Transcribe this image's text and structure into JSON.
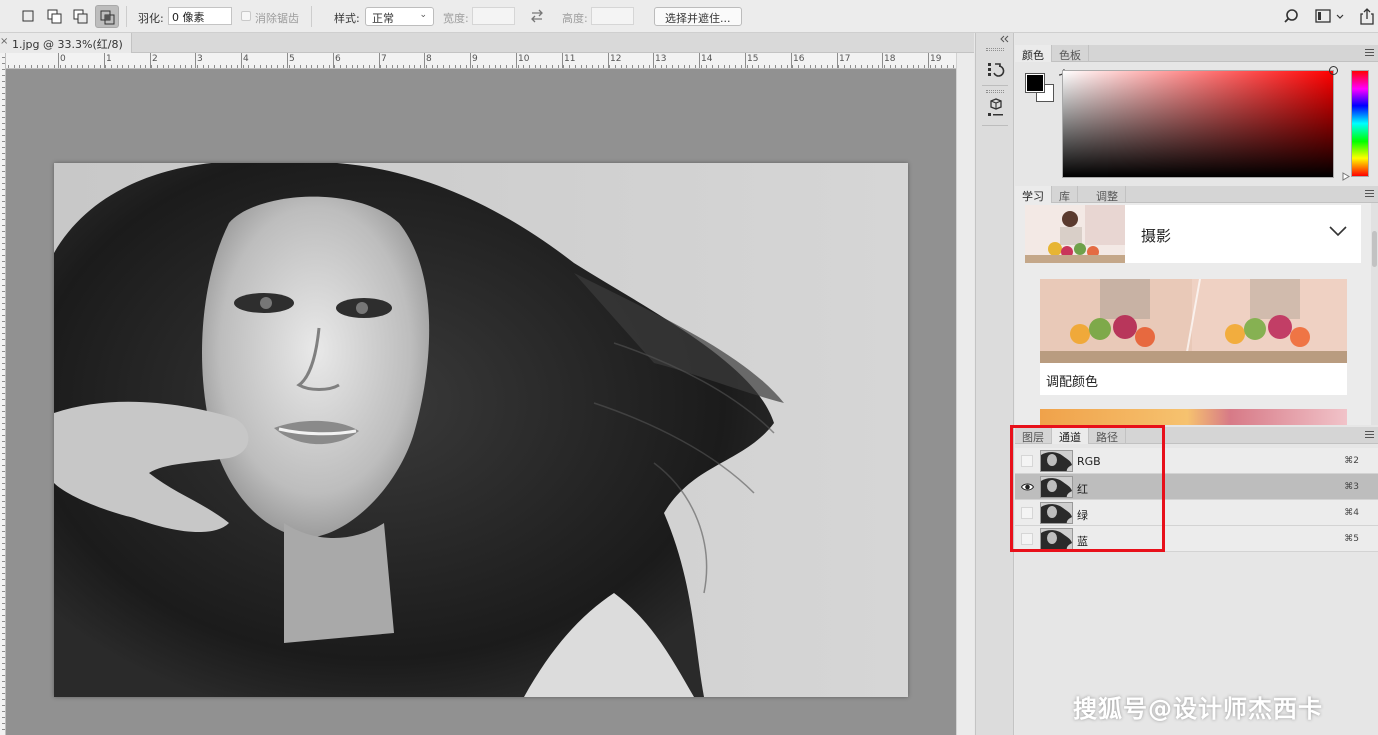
{
  "options_bar": {
    "feather_label": "羽化:",
    "feather_value": "0 像素",
    "antialias_label": "消除锯齿",
    "style_label": "样式:",
    "style_value": "正常",
    "width_label": "宽度:",
    "height_label": "高度:",
    "select_mask_label": "选择并遮住..."
  },
  "document": {
    "tab_title": "1.jpg @ 33.3%(红/8)",
    "close_glyph": "×"
  },
  "ruler": {
    "labels": [
      "0",
      "1",
      "2",
      "3",
      "4",
      "5",
      "6",
      "7",
      "8",
      "9",
      "10",
      "11",
      "12",
      "13",
      "14",
      "15",
      "16",
      "17",
      "18",
      "19"
    ]
  },
  "color_panel": {
    "tabs": [
      "颜色",
      "色板"
    ],
    "active_tab": 0,
    "foreground": "#000000",
    "background": "#ffffff"
  },
  "learn_panel": {
    "tabs": [
      "学习",
      "库",
      "调整"
    ],
    "active_tab": 0,
    "category_title": "摄影",
    "tutorial_title": "调配颜色"
  },
  "channels_panel": {
    "tabs": [
      "图层",
      "通道",
      "路径"
    ],
    "active_tab": 1,
    "channels": [
      {
        "name": "RGB",
        "shortcut": "⌘2",
        "visible": false,
        "selected": false
      },
      {
        "name": "红",
        "shortcut": "⌘3",
        "visible": true,
        "selected": true
      },
      {
        "name": "绿",
        "shortcut": "⌘4",
        "visible": false,
        "selected": false
      },
      {
        "name": "蓝",
        "shortcut": "⌘5",
        "visible": false,
        "selected": false
      }
    ]
  },
  "highlight_color": "#e8101a",
  "watermark": "搜狐号@设计师杰西卡"
}
